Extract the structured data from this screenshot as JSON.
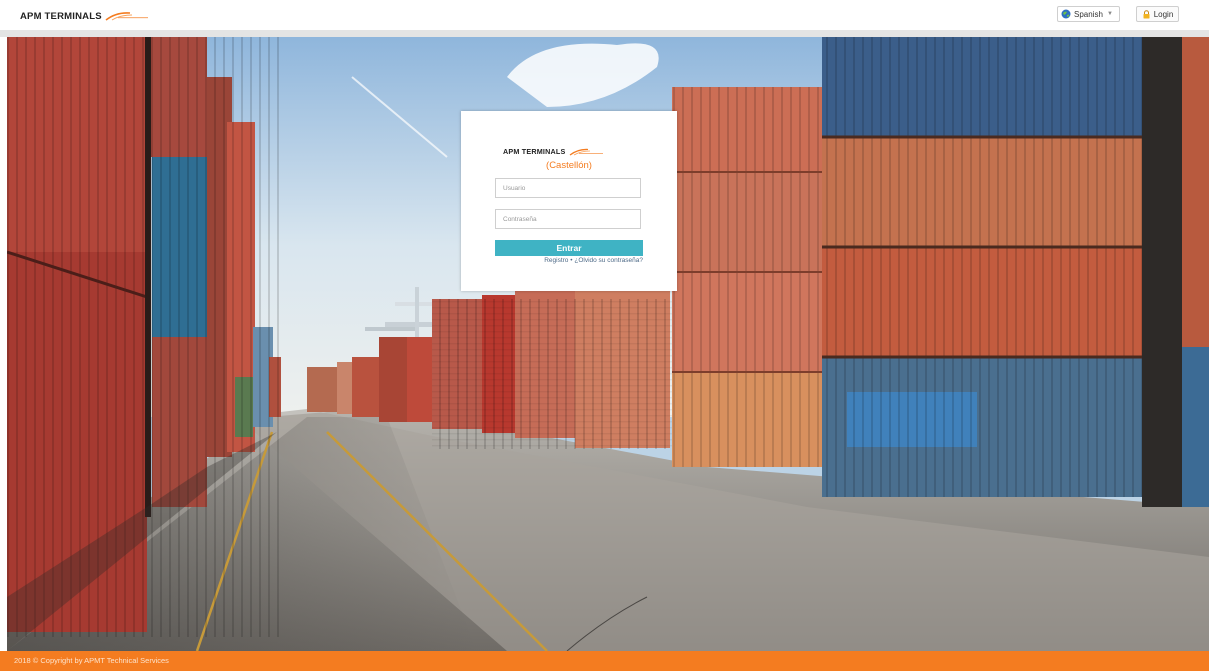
{
  "header": {
    "logo_text": "APM TERMINALS",
    "language": {
      "selected": "Spanish",
      "icon": "globe-icon"
    },
    "login_label": "Login",
    "login_icon": "lock-icon"
  },
  "login_card": {
    "logo_text": "APM TERMINALS",
    "terminal_name": "(Castellón)",
    "username_placeholder": "Usuario",
    "password_placeholder": "Contraseña",
    "submit_label": "Entrar",
    "register_link": "Registro",
    "separator": "•",
    "forgot_link": "¿Olvido su contraseña?"
  },
  "footer": {
    "copyright": "2018 © Copyright by APMT Technical Services"
  },
  "colors": {
    "brand_orange": "#f47c20",
    "button_teal": "#3fb3c4"
  }
}
